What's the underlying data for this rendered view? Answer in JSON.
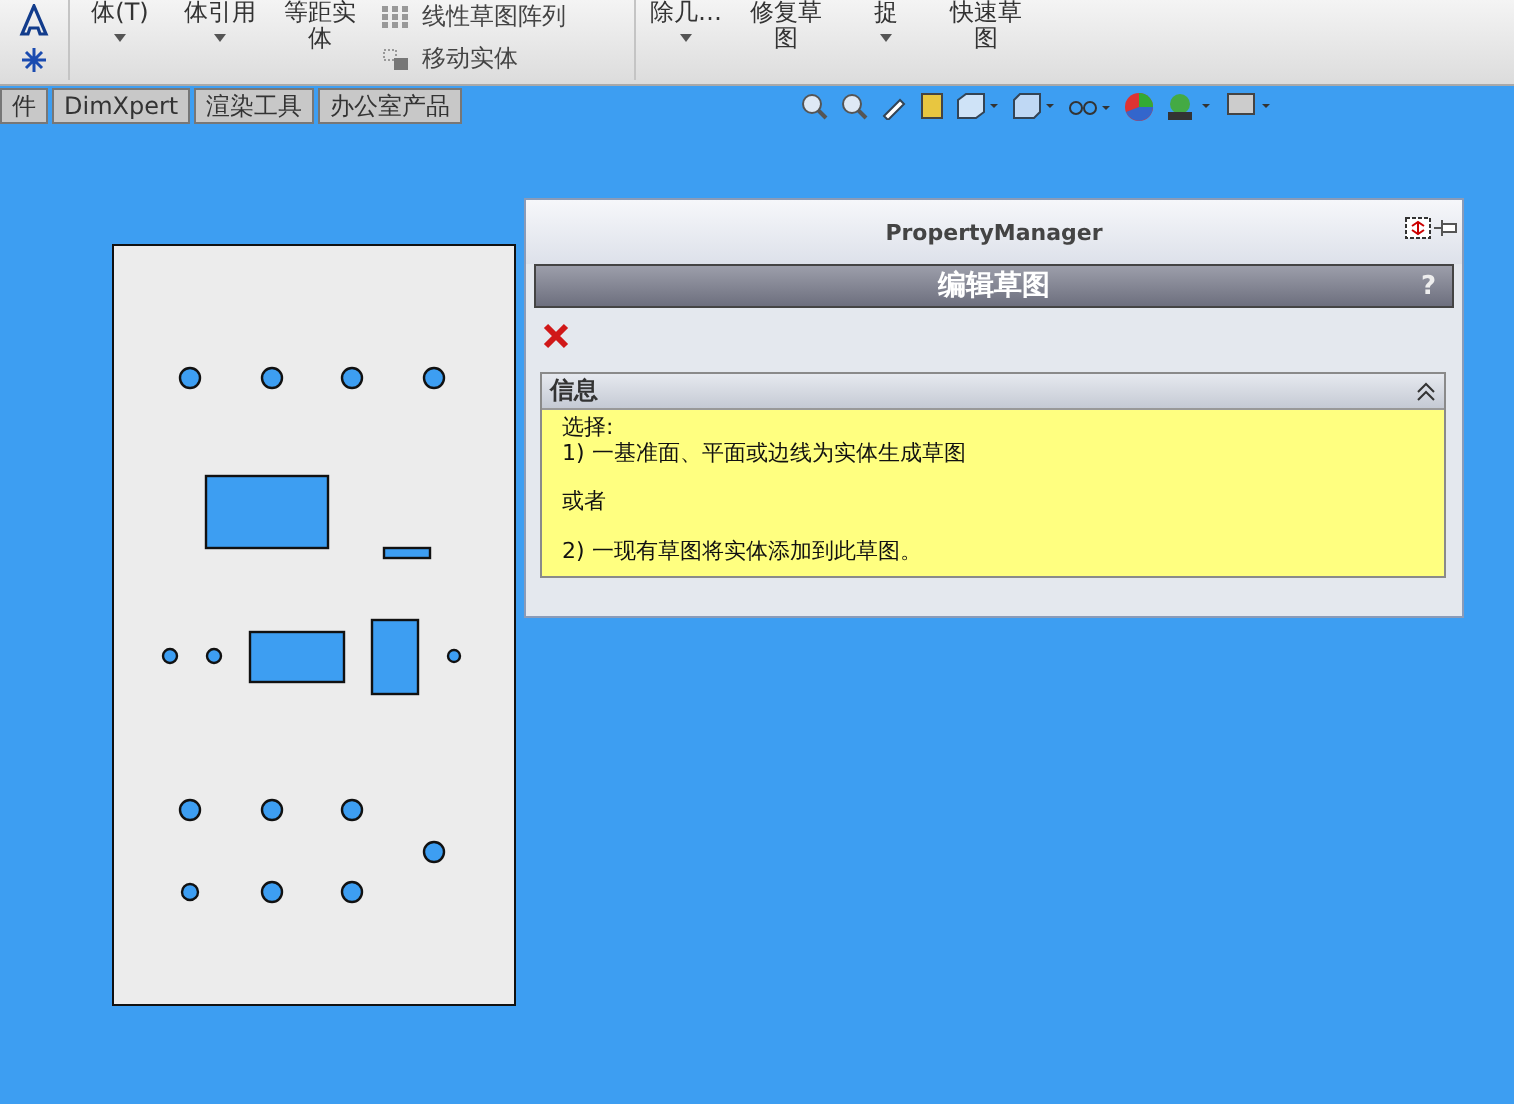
{
  "ribbon": {
    "items": [
      {
        "kind": "large",
        "label": "体(T)",
        "caret": true
      },
      {
        "kind": "large",
        "label": "体引用",
        "caret": true
      },
      {
        "kind": "large",
        "label": "等距实体",
        "caret": false
      },
      {
        "kind": "pair",
        "labels": [
          "线性草图阵列",
          "移动实体"
        ]
      },
      {
        "kind": "large",
        "label": "除几…",
        "caret": true
      },
      {
        "kind": "large",
        "label": "修复草图",
        "caret": false
      },
      {
        "kind": "large",
        "label": "捉",
        "caret": true
      },
      {
        "kind": "large",
        "label": "快速草图",
        "caret": false
      }
    ]
  },
  "tabs": [
    {
      "label": "件",
      "selected": false
    },
    {
      "label": "DimXpert",
      "selected": false
    },
    {
      "label": "渲染工具",
      "selected": false
    },
    {
      "label": "办公室产品",
      "selected": false
    }
  ],
  "property_manager": {
    "title": "PropertyManager",
    "header": "编辑草图",
    "help": "?",
    "info": {
      "title": "信息",
      "expanded": true,
      "paragraphs": [
        [
          "选择:",
          "1) 一基准面、平面或边线为实体生成草图"
        ],
        [
          "或者"
        ],
        [
          "2) 一现有草图将实体添加到此草图。"
        ]
      ]
    }
  }
}
